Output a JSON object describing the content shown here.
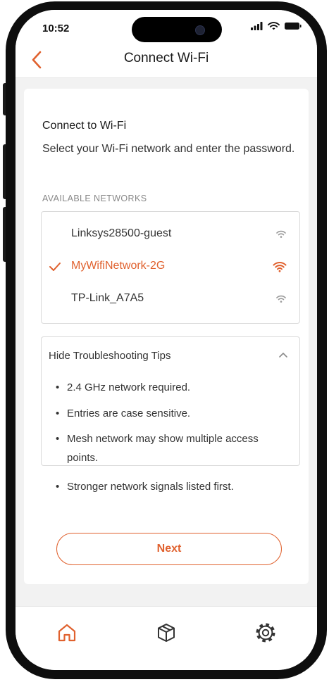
{
  "status_bar": {
    "time": "10:52"
  },
  "header": {
    "title": "Connect Wi-Fi"
  },
  "content": {
    "heading": "Connect to Wi-Fi",
    "description": "Select your Wi-Fi network and enter the password.",
    "section_label": "AVAILABLE NETWORKS",
    "networks": [
      {
        "name": "Linksys28500-guest",
        "selected": false
      },
      {
        "name": "MyWifiNetwork-2G",
        "selected": true
      },
      {
        "name": "TP-Link_A7A5",
        "selected": false
      }
    ],
    "tips": {
      "toggle_label": "Hide Troubleshooting Tips",
      "items": [
        "2.4 GHz network required.",
        "Entries are case sensitive.",
        "Mesh network may show multiple access points.",
        "Stronger network signals listed first."
      ]
    },
    "next_label": "Next"
  },
  "tabbar": {
    "items": [
      "home-icon",
      "box-icon",
      "gear-icon"
    ]
  },
  "colors": {
    "accent": "#e0612e",
    "background": "#f2f2f2",
    "text": "#1a1a1a"
  }
}
